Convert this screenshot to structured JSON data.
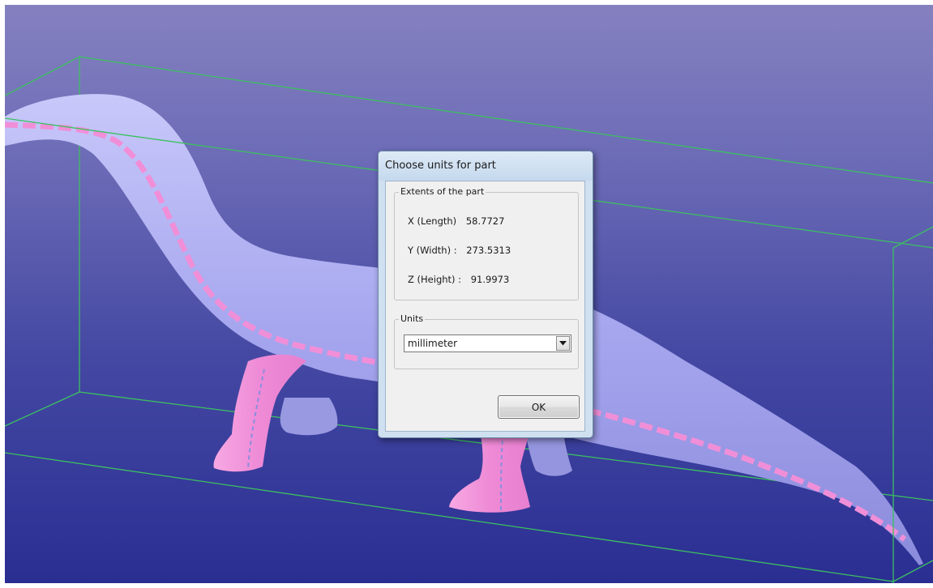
{
  "dialog": {
    "title": "Choose units for part",
    "extents_group": {
      "legend": "Extents of the part",
      "x_label": "X (Length)",
      "x_value": "58.7727",
      "y_label": "Y (Width) :",
      "y_value": "273.5313",
      "z_label": "Z (Height) :",
      "z_value": "91.9973"
    },
    "units_group": {
      "legend": "Units",
      "selected": "millimeter"
    },
    "ok_label": "OK"
  },
  "colors": {
    "background_top": "#8581c0",
    "background_bottom": "#2a2e92",
    "model_body": "#a9a9f3",
    "model_pink": "#f08fd8",
    "bounding_box": "#3cc060"
  },
  "icons": {
    "dropdown": "chevron-down-icon"
  }
}
